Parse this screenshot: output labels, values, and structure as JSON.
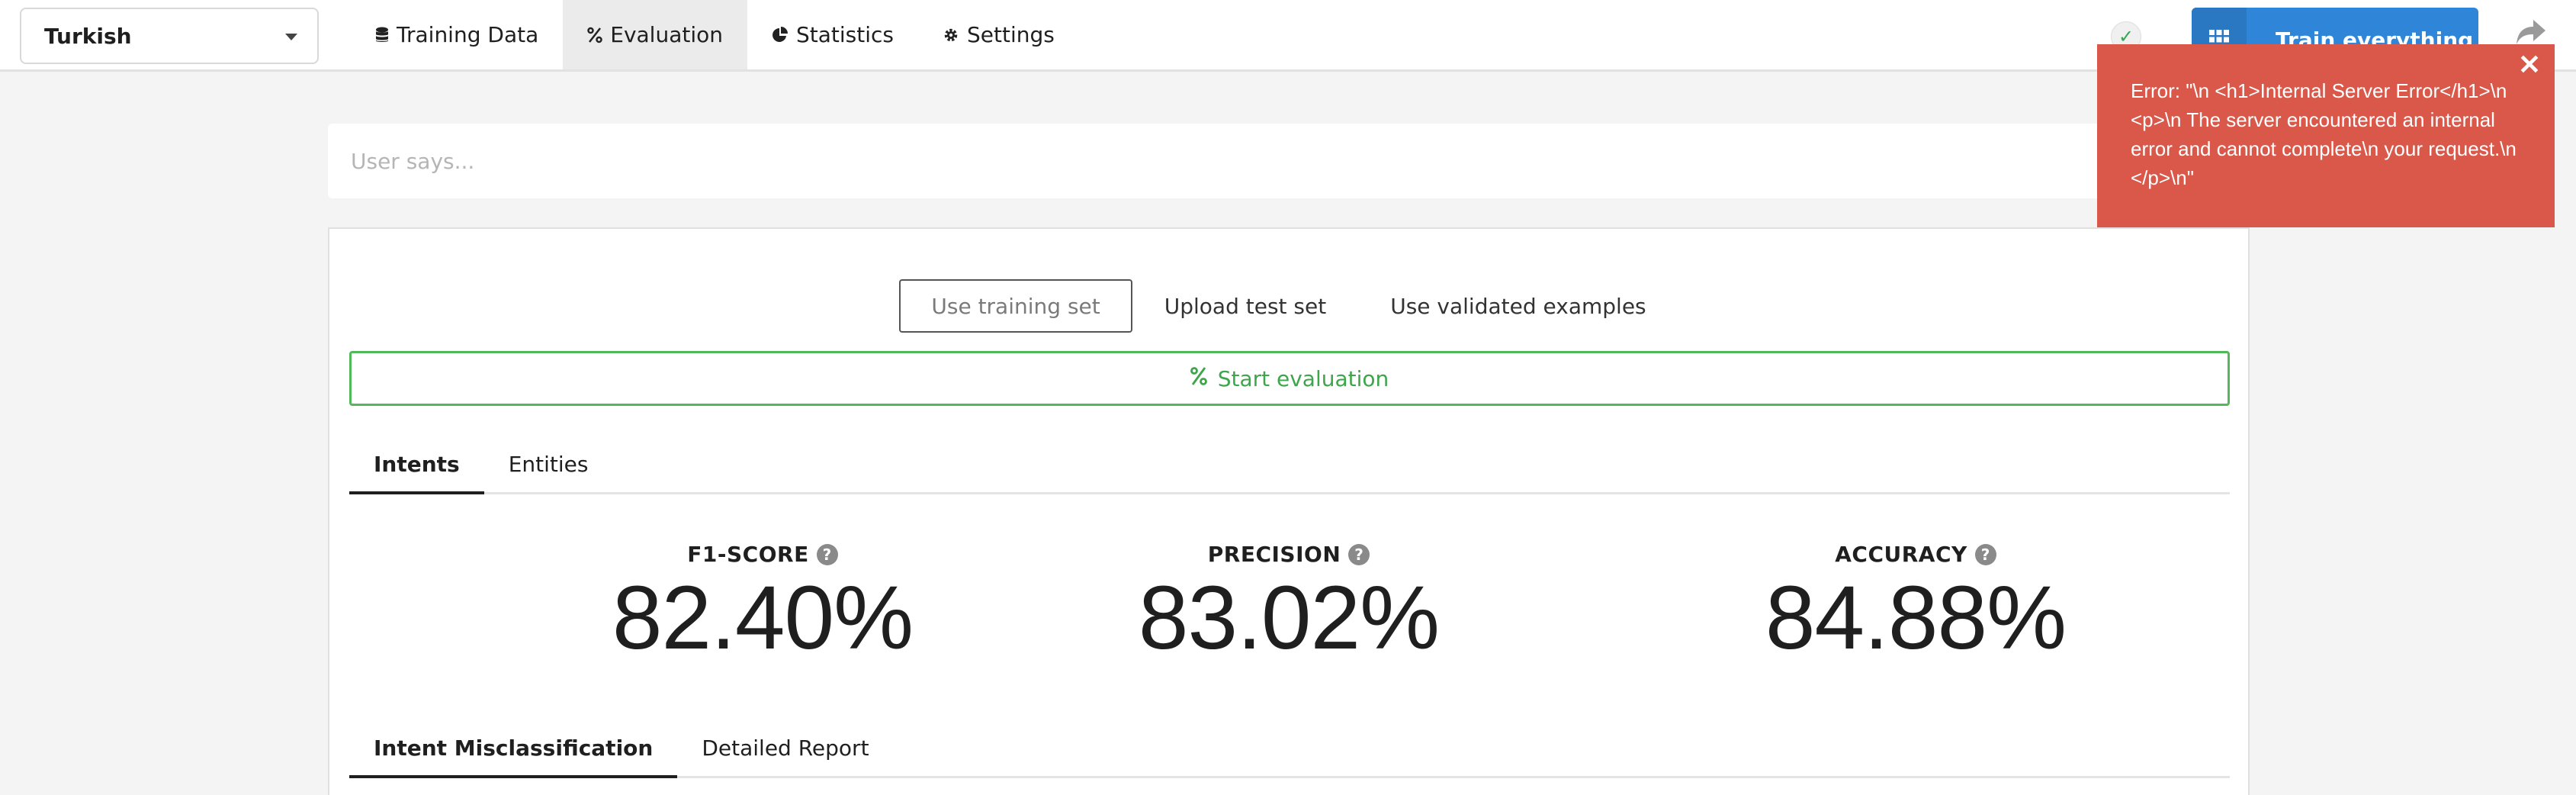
{
  "language_select": {
    "value": "Turkish"
  },
  "nav": [
    {
      "label": "Training Data",
      "icon": "database-icon",
      "active": false
    },
    {
      "label": "Evaluation",
      "icon": "percent-icon",
      "active": true
    },
    {
      "label": "Statistics",
      "icon": "pie-chart-icon",
      "active": false
    },
    {
      "label": "Settings",
      "icon": "gear-icon",
      "active": false
    }
  ],
  "status": {
    "icon": "check-icon"
  },
  "train_button": {
    "label": "Train everything",
    "icon": "grid-icon"
  },
  "share": {
    "icon": "share-icon"
  },
  "utterance": {
    "placeholder": "User says..."
  },
  "eval_sources": [
    {
      "label": "Use training set",
      "selected": true
    },
    {
      "label": "Upload test set",
      "selected": false
    },
    {
      "label": "Use validated examples",
      "selected": false
    }
  ],
  "start_evaluation": {
    "label": "Start evaluation",
    "icon": "percent-icon"
  },
  "result_tabs": [
    {
      "label": "Intents",
      "active": true
    },
    {
      "label": "Entities",
      "active": false
    }
  ],
  "metrics": [
    {
      "label": "F1-SCORE",
      "value": "82.40%"
    },
    {
      "label": "PRECISION",
      "value": "83.02%"
    },
    {
      "label": "ACCURACY",
      "value": "84.88%"
    }
  ],
  "report_tabs": [
    {
      "label": "Intent Misclassification",
      "active": true
    },
    {
      "label": "Detailed Report",
      "active": false
    }
  ],
  "error_toast": {
    "message": "Error: \"\\n <h1>Internal Server Error</h1>\\n <p>\\n The server encountered an internal error and cannot complete\\n your request.\\n </p>\\n\"",
    "color": "#d9584a"
  },
  "colors": {
    "accent_blue": "#2f86d8",
    "success_green": "#3ea64a",
    "error_red": "#d9584a"
  }
}
